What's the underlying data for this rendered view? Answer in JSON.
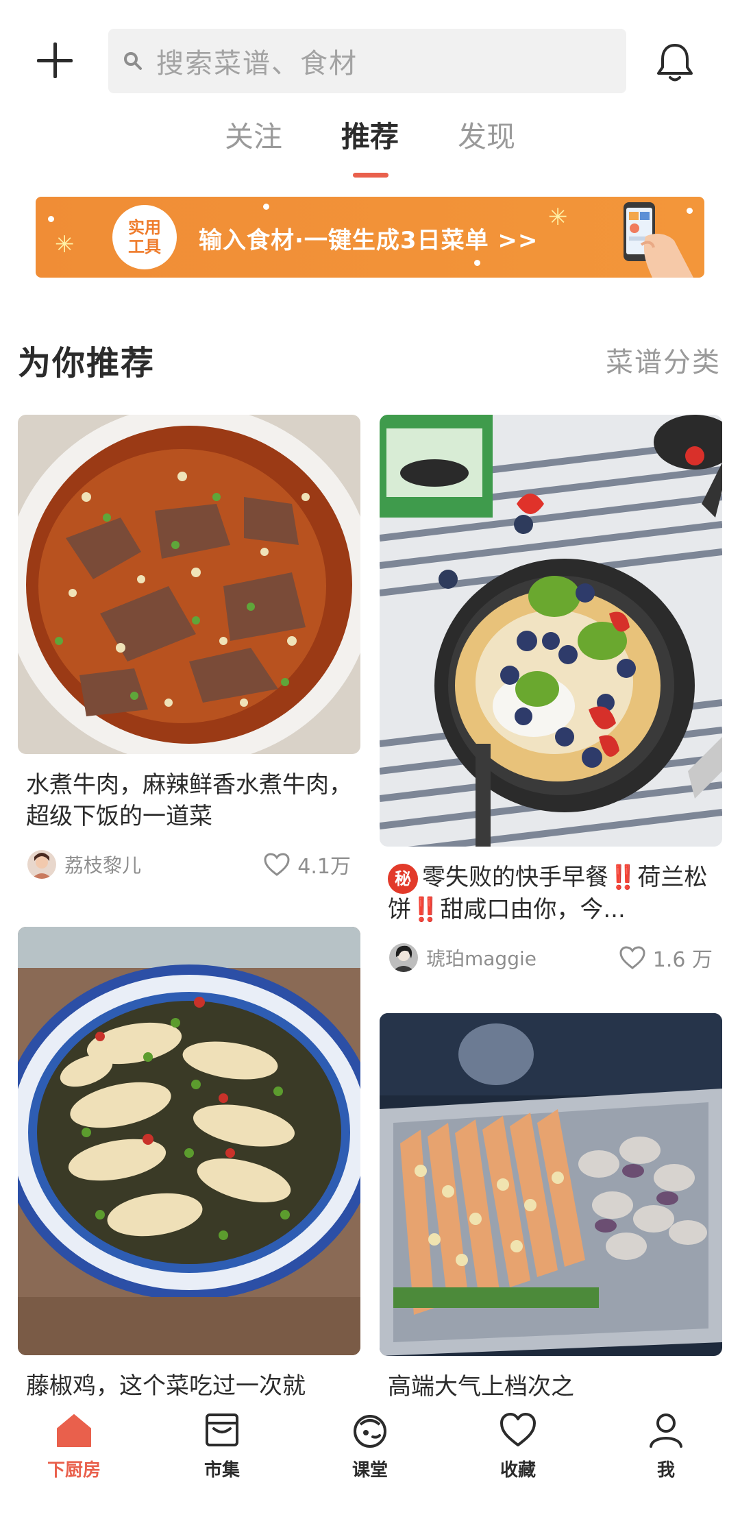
{
  "header": {
    "search_placeholder": "搜索菜谱、食材"
  },
  "tabs": [
    {
      "label": "关注",
      "active": false
    },
    {
      "label": "推荐",
      "active": true
    },
    {
      "label": "发现",
      "active": false
    }
  ],
  "banner": {
    "badge_line1": "实用",
    "badge_line2": "工具",
    "text": "输入食材·一键生成3日菜单 >>"
  },
  "section": {
    "title": "为你推荐",
    "link": "菜谱分类"
  },
  "feed": [
    {
      "title": "水煮牛肉，麻辣鲜香水煮牛肉，超级下饭的一道菜",
      "author": "荔枝黎儿",
      "likes": "4.1万",
      "image": "spicy-boiled-beef-photo"
    },
    {
      "title_prefix_badge": "秘",
      "title_part1": "零失败的快手早餐",
      "title_bang1": "‼️",
      "title_part2": "荷兰松饼",
      "title_bang2": "‼️",
      "title_part3": "甜咸口由你，今...",
      "author": "琥珀maggie",
      "likes": "1.6 万",
      "image": "dutch-baby-pancake-photo"
    },
    {
      "title": "藤椒鸡，这个菜吃过一次就",
      "image": "green-pepper-chicken-photo"
    },
    {
      "title": "高端大气上档次之",
      "image": "roasted-shrimp-oven-photo"
    }
  ],
  "bottom_nav": [
    {
      "label": "下厨房",
      "icon": "home-icon",
      "active": true
    },
    {
      "label": "市集",
      "icon": "market-icon",
      "active": false
    },
    {
      "label": "课堂",
      "icon": "class-icon",
      "active": false
    },
    {
      "label": "收藏",
      "icon": "heart-icon",
      "active": false
    },
    {
      "label": "我",
      "icon": "profile-icon",
      "active": false
    }
  ],
  "colors": {
    "accent": "#e9604c",
    "banner": "#f08d36"
  }
}
